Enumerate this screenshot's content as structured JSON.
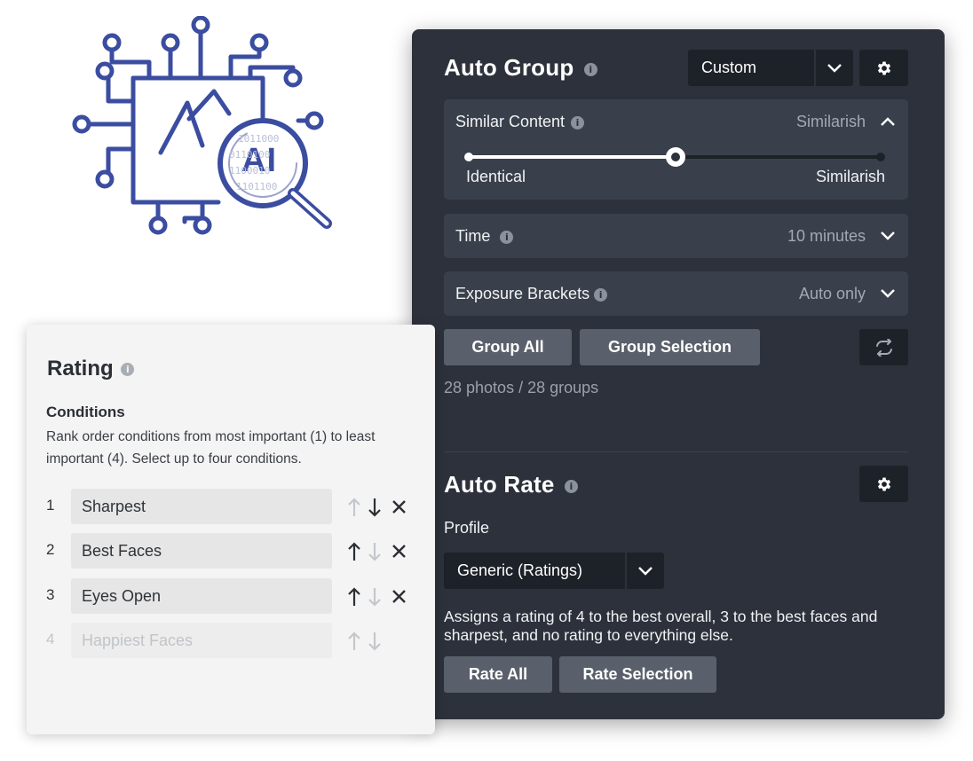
{
  "colors": {
    "logo_blue": "#3b4da0",
    "panel_bg": "#2c313b",
    "card_bg": "#f4f4f4"
  },
  "logo": {
    "text": "AI",
    "binary_lines": [
      "1011000",
      "0110100",
      "1100010",
      "1101100"
    ]
  },
  "auto_group": {
    "title": "Auto Group",
    "info_icon": "i",
    "preset": {
      "value": "Custom",
      "icon": "chevron-down-icon"
    },
    "settings_icon": "gear-icon",
    "similar_content": {
      "label": "Similar Content",
      "value": "Similarish",
      "slider_level": 0.5,
      "min_label": "Identical",
      "max_label": "Similarish"
    },
    "time": {
      "label": "Time",
      "value": "10 minutes"
    },
    "exposure": {
      "label": "Exposure Brackets",
      "value": "Auto only"
    },
    "group_all_label": "Group All",
    "group_selection_label": "Group Selection",
    "swap_icon": "swap-arrows-icon",
    "status": "28 photos / 28 groups"
  },
  "auto_rate": {
    "title": "Auto Rate",
    "profile_label": "Profile",
    "profile_value": "Generic (Ratings)",
    "description": "Assigns a rating of 4 to the best overall, 3 to the best faces and sharpest, and no rating to everything else.",
    "rate_all_label": "Rate All",
    "rate_selection_label": "Rate Selection"
  },
  "rating": {
    "title": "Rating",
    "conditions_label": "Conditions",
    "description": "Rank order conditions from most important (1) to least important (4). Select up to four conditions.",
    "conditions": [
      {
        "num": "1",
        "label": "Sharpest"
      },
      {
        "num": "2",
        "label": "Best Faces"
      },
      {
        "num": "3",
        "label": "Eyes Open"
      },
      {
        "num": "4",
        "label": "Happiest Faces"
      }
    ]
  }
}
